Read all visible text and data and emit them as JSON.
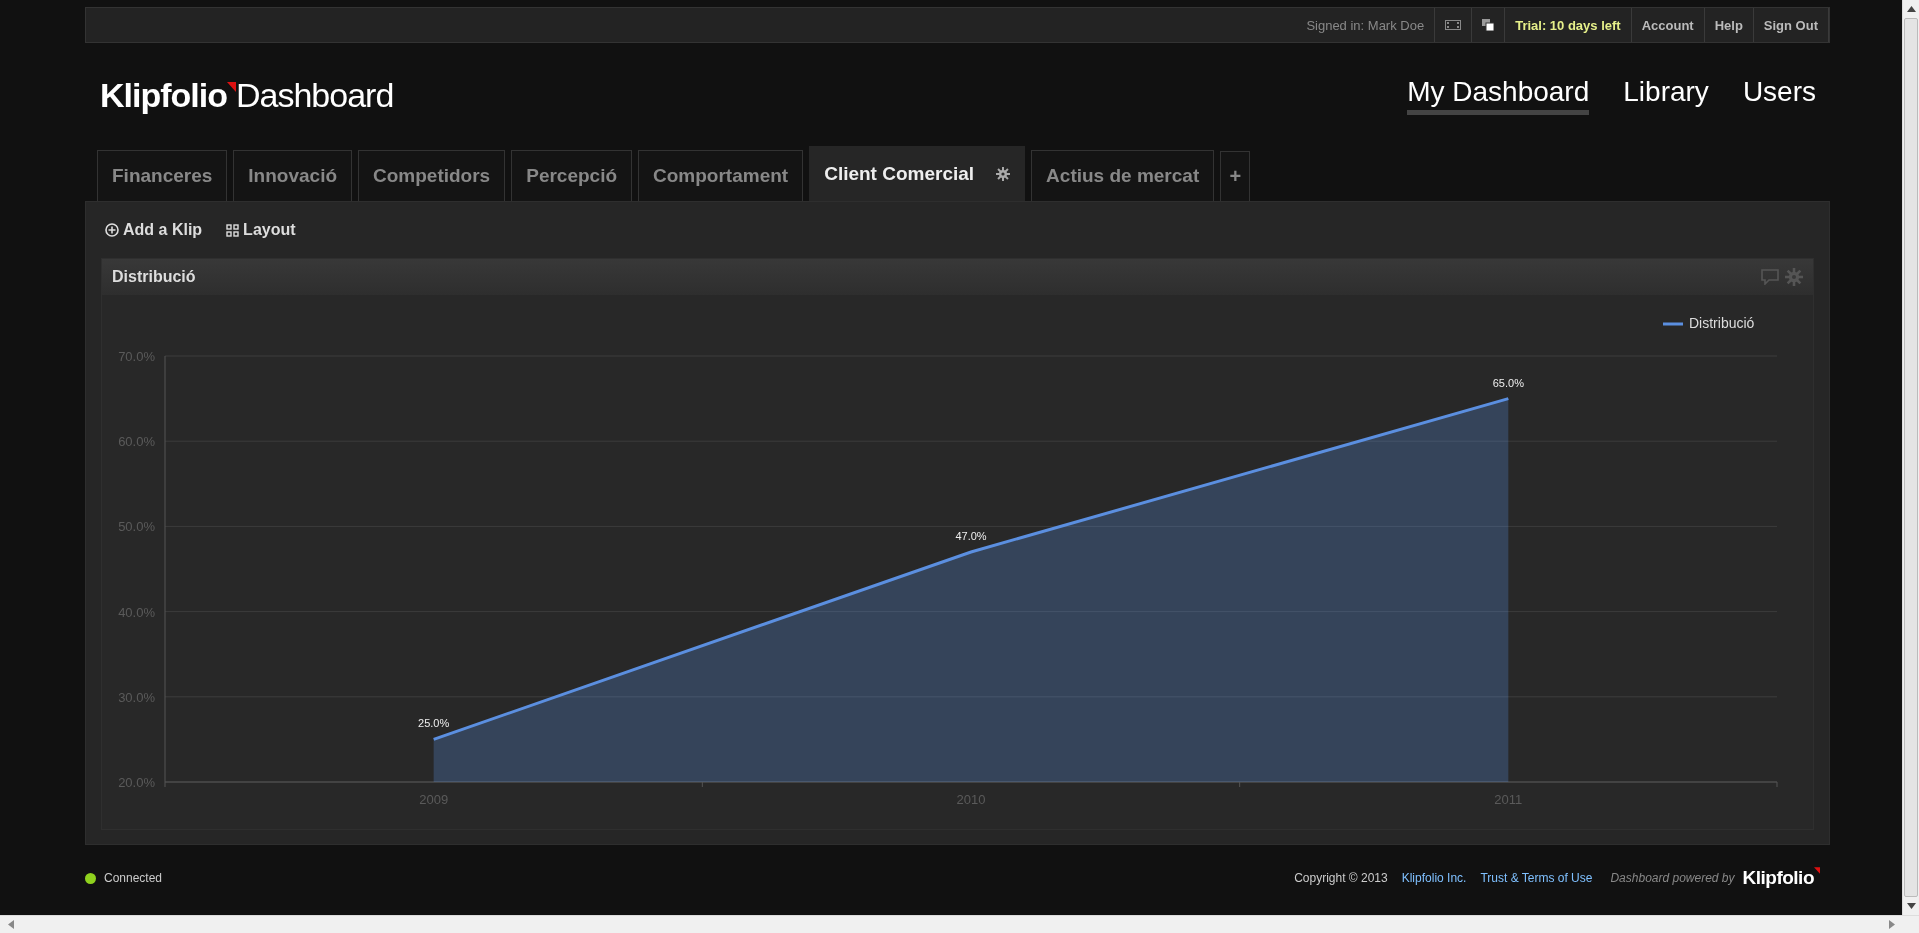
{
  "top_bar": {
    "signed_in": "Signed in: Mark Doe",
    "trial": "Trial: 10 days left",
    "links": [
      {
        "label": "Account"
      },
      {
        "label": "Help"
      },
      {
        "label": "Sign Out"
      }
    ]
  },
  "logo": {
    "brand": "Klipfolio",
    "product": "Dashboard"
  },
  "main_nav": [
    {
      "label": "My Dashboard",
      "selected": true
    },
    {
      "label": "Library",
      "selected": false
    },
    {
      "label": "Users",
      "selected": false
    }
  ],
  "tabs": [
    {
      "label": "Financeres",
      "selected": false,
      "settings": false
    },
    {
      "label": "Innovació",
      "selected": false,
      "settings": false
    },
    {
      "label": "Competidors",
      "selected": false,
      "settings": false
    },
    {
      "label": "Percepció",
      "selected": false,
      "settings": false
    },
    {
      "label": "Comportament",
      "selected": false,
      "settings": false
    },
    {
      "label": "Client Comercial",
      "selected": true,
      "settings": true
    },
    {
      "label": "Actius de mercat",
      "selected": false,
      "settings": false
    }
  ],
  "add_tab": "+",
  "toolbar": [
    {
      "label": "Add a Klip",
      "kind": "add"
    },
    {
      "label": "Layout",
      "kind": "layout"
    }
  ],
  "klip": {
    "title": "Distribució",
    "chart_data": {
      "type": "area",
      "categories": [
        "2009",
        "2010",
        "2011"
      ],
      "series": [
        {
          "name": "Distribució",
          "color": "#5b8fe0",
          "values": [
            25,
            47,
            65
          ]
        }
      ],
      "ylim": [
        20,
        70
      ],
      "grid": true,
      "yticks": [
        {
          "value": 20,
          "label": "20.0%"
        },
        {
          "value": 30,
          "label": "30.0%"
        },
        {
          "value": 40,
          "label": "40.0%"
        },
        {
          "value": 50,
          "label": "50.0%"
        },
        {
          "value": 60,
          "label": "60.0%"
        },
        {
          "value": 70,
          "label": "70.0%"
        }
      ],
      "value_labels": [
        "25.0%",
        "47.0%",
        "65.0%"
      ]
    }
  },
  "footer": {
    "status": {
      "label": "Connected",
      "color": "#8fd11e"
    },
    "copyright": "Copyright © 2013",
    "company": "Klipfolio Inc.",
    "terms": "Trust & Terms of Use",
    "powered": "Dashboard powered by",
    "brand": "Klipfolio"
  }
}
